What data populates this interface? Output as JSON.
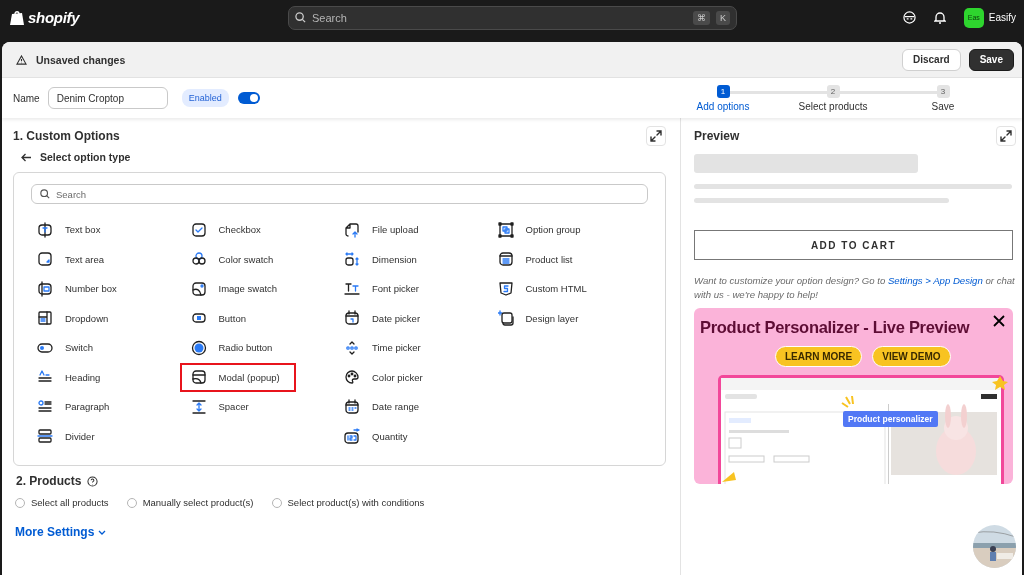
{
  "topbar": {
    "brand": "shopify",
    "search_placeholder": "Search",
    "shortcut_keys": [
      "⌘",
      "K"
    ],
    "store_initials": "Eas",
    "store_name": "Easify"
  },
  "save_bar": {
    "title": "Unsaved changes",
    "buttons": [
      {
        "label": "Discard",
        "kind": "secondary"
      },
      {
        "label": "Save",
        "kind": "primary"
      }
    ]
  },
  "name_bar": {
    "label": "Name",
    "value": "Denim Croptop",
    "status": "Enabled",
    "enabled": true
  },
  "steps": [
    {
      "number": "1",
      "label": "Add options",
      "selected": true
    },
    {
      "number": "2",
      "label": "Select products",
      "selected": false
    },
    {
      "number": "3",
      "label": "Save",
      "selected": false
    }
  ],
  "custom_options": {
    "title": "1. Custom Options",
    "back_label": "Select option type",
    "search_placeholder": "Search",
    "option_columns": [
      {
        "items": [
          {
            "label": "Text box",
            "selected": false
          },
          {
            "label": "Text area",
            "selected": false
          },
          {
            "label": "Number box",
            "selected": false
          },
          {
            "label": "Dropdown",
            "selected": false
          },
          {
            "label": "Switch",
            "selected": false
          },
          {
            "label": "Heading",
            "selected": false
          },
          {
            "label": "Paragraph",
            "selected": false
          },
          {
            "label": "Divider",
            "selected": false
          }
        ]
      },
      {
        "items": [
          {
            "label": "Checkbox",
            "selected": false
          },
          {
            "label": "Color swatch",
            "selected": false
          },
          {
            "label": "Image swatch",
            "selected": false
          },
          {
            "label": "Button",
            "selected": false
          },
          {
            "label": "Radio button",
            "selected": false
          },
          {
            "label": "Modal (popup)",
            "selected": true
          },
          {
            "label": "Spacer",
            "selected": false
          }
        ]
      },
      {
        "items": [
          {
            "label": "File upload",
            "selected": false
          },
          {
            "label": "Dimension",
            "selected": false
          },
          {
            "label": "Font picker",
            "selected": false
          },
          {
            "label": "Date picker",
            "selected": false
          },
          {
            "label": "Time picker",
            "selected": false
          },
          {
            "label": "Color picker",
            "selected": false
          },
          {
            "label": "Date range",
            "selected": false
          },
          {
            "label": "Quantity",
            "selected": false
          }
        ]
      },
      {
        "items": [
          {
            "label": "Option group",
            "selected": false
          },
          {
            "label": "Product list",
            "selected": false
          },
          {
            "label": "Custom HTML",
            "selected": false
          },
          {
            "label": "Design layer",
            "selected": false
          }
        ]
      }
    ]
  },
  "products": {
    "title": "2. Products",
    "choices": [
      {
        "label": "Select all products",
        "selected": false
      },
      {
        "label": "Manually select product(s)",
        "selected": false
      },
      {
        "label": "Select product(s) with conditions",
        "selected": false
      }
    ]
  },
  "more_settings": "More Settings",
  "preview": {
    "title": "Preview",
    "add_to_cart": "ADD TO CART",
    "help_text": "Want to customize your option design? Go to ",
    "help_link": "Settings > App Design",
    "help_text_end": " or chat with us - we're happy to help!",
    "banner": {
      "title": "Product Personalizer - Live Preview",
      "buttons": [
        "LEARN MORE",
        "VIEW DEMO"
      ],
      "tag": "Product personalizer"
    }
  }
}
